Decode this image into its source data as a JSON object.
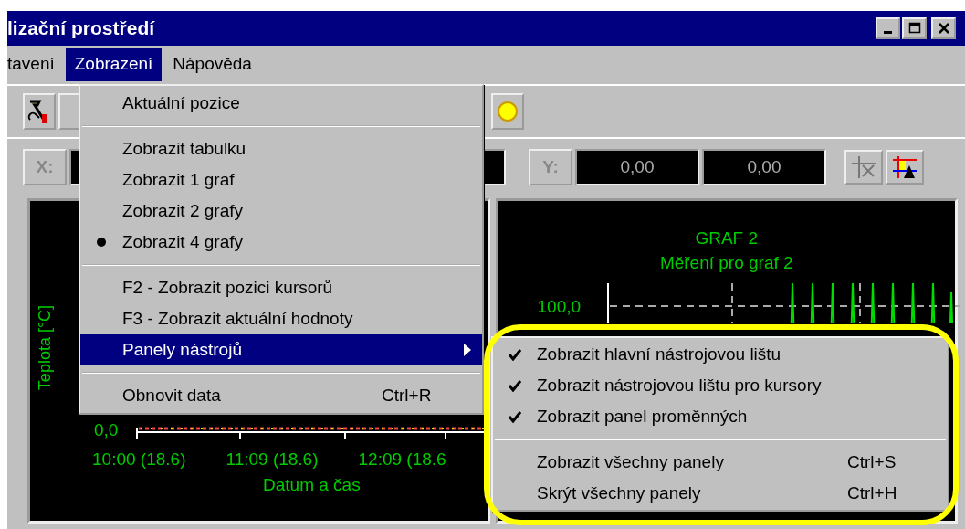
{
  "window": {
    "title": "lizační prostředí"
  },
  "menu_bar": [
    {
      "label": "tavení",
      "selected": false
    },
    {
      "label": "Zobrazení",
      "selected": true
    },
    {
      "label": "Nápověda",
      "selected": false
    }
  ],
  "cursor_bar": {
    "x_label": "X:",
    "y_label": "Y:",
    "y_values": [
      "0,00",
      "0,00"
    ]
  },
  "charts": [
    {
      "y_label": "Teplota [°C]",
      "y_tick": "0,0",
      "x_ticks": [
        "10:00 (18.6)",
        "11:09 (18.6)",
        "12:09 (18.6"
      ],
      "x_label": "Datum a čas"
    },
    {
      "title": "GRAF 2",
      "subtitle": "Měření pro graf 2",
      "y_tick": "100,0"
    }
  ],
  "view_menu": {
    "groups": [
      [
        {
          "label": "Aktuální pozice",
          "kind": "command",
          "selected": false
        }
      ],
      [
        {
          "label": "Zobrazit tabulku",
          "kind": "radio",
          "checked": false,
          "selected": false
        },
        {
          "label": "Zobrazit 1 graf",
          "kind": "radio",
          "checked": false,
          "selected": false
        },
        {
          "label": "Zobrazit 2 grafy",
          "kind": "radio",
          "checked": false,
          "selected": false
        },
        {
          "label": "Zobrazit 4 grafy",
          "kind": "radio",
          "checked": true,
          "selected": false
        }
      ],
      [
        {
          "label": "F2 - Zobrazit pozici kursorů",
          "kind": "command",
          "selected": false
        },
        {
          "label": "F3 - Zobrazit aktuální hodnoty",
          "kind": "command",
          "selected": false
        },
        {
          "label": "Panely nástrojů",
          "kind": "submenu",
          "selected": true
        }
      ],
      [
        {
          "label": "Obnovit data",
          "kind": "command",
          "shortcut": "Ctrl+R",
          "selected": false
        }
      ]
    ]
  },
  "toolbars_submenu": {
    "groups": [
      [
        {
          "label": "Zobrazit hlavní nástrojovou lištu",
          "kind": "check",
          "checked": true
        },
        {
          "label": "Zobrazit nástrojovou lištu pro kursory",
          "kind": "check",
          "checked": true
        },
        {
          "label": "Zobrazit panel proměnných",
          "kind": "check",
          "checked": true
        }
      ],
      [
        {
          "label": "Zobrazit všechny panely",
          "kind": "command",
          "shortcut": "Ctrl+S"
        },
        {
          "label": "Skrýt všechny panely",
          "kind": "command",
          "shortcut": "Ctrl+H"
        }
      ]
    ]
  }
}
